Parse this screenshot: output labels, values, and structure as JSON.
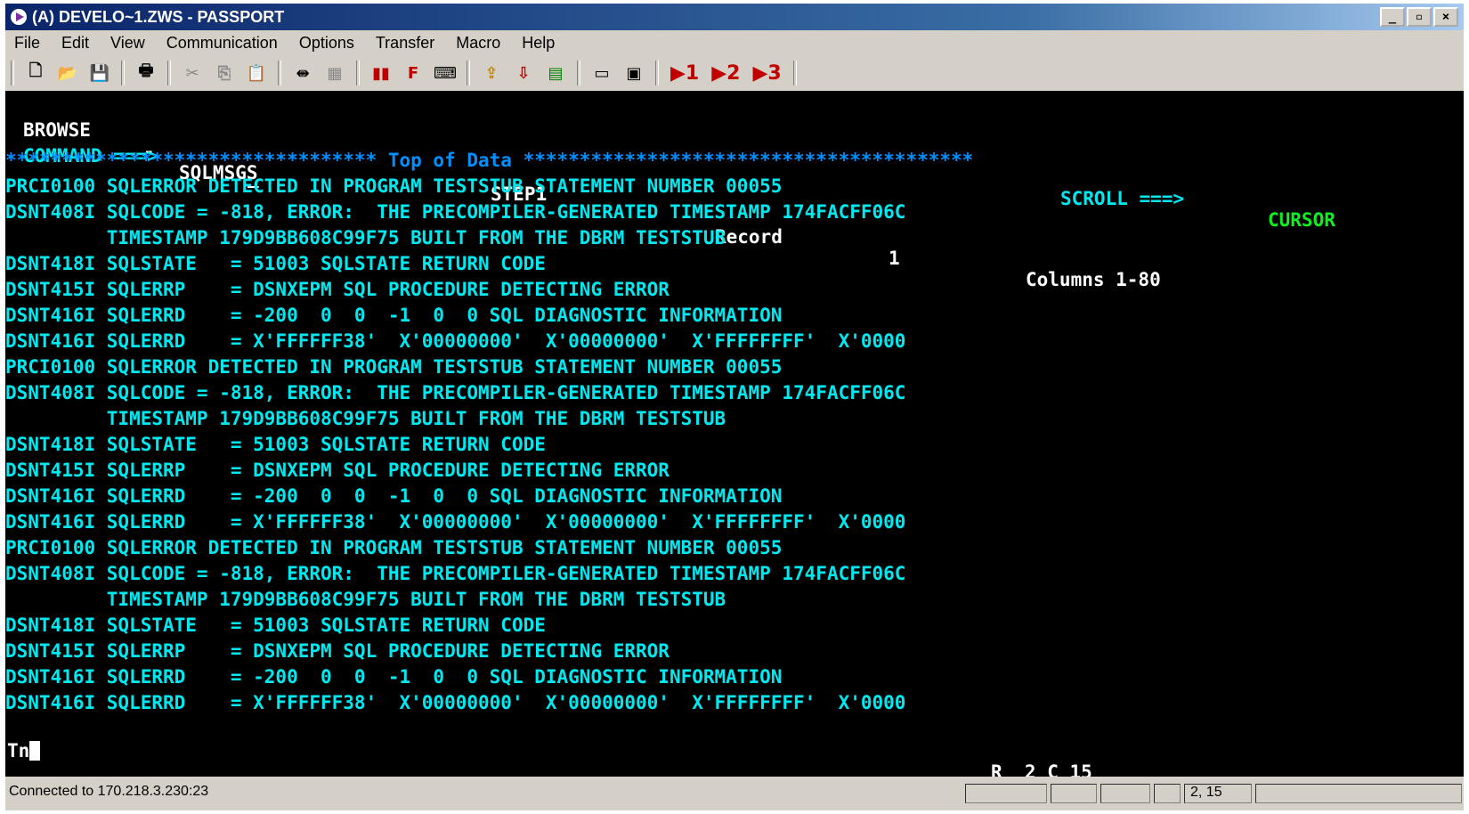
{
  "window": {
    "title": "(A) DEVELO~1.ZWS - PASSPORT",
    "controls": [
      "_",
      "▫",
      "×"
    ]
  },
  "menu": [
    "File",
    "Edit",
    "View",
    "Communication",
    "Options",
    "Transfer",
    "Macro",
    "Help"
  ],
  "toolbar": {
    "macro_buttons": [
      "▶1",
      "▶2",
      "▶3"
    ]
  },
  "terminal": {
    "header": {
      "mode": "BROWSE",
      "dash": "-",
      "dataset": "SQLMSGS",
      "step": "STEP1",
      "dash2": "-",
      "record_label": "Record",
      "record_value": "1",
      "columns": "Columns 1-80",
      "command_label": "COMMAND ===>",
      "command_value": "_",
      "scroll_label": "SCROLL ===>",
      "scroll_value": "CURSOR"
    },
    "top_of_data": "********************************* Top of Data ****************************************",
    "lines": [
      "PRCI0100 SQLERROR DETECTED IN PROGRAM TESTSTUB STATEMENT NUMBER 00055",
      "DSNT408I SQLCODE = -818, ERROR:  THE PRECOMPILER-GENERATED TIMESTAMP 174FACFF06C",
      "         TIMESTAMP 179D9BB608C99F75 BUILT FROM THE DBRM TESTSTUB",
      "DSNT418I SQLSTATE   = 51003 SQLSTATE RETURN CODE",
      "DSNT415I SQLERRP    = DSNXEPM SQL PROCEDURE DETECTING ERROR",
      "DSNT416I SQLERRD    = -200  0  0  -1  0  0 SQL DIAGNOSTIC INFORMATION",
      "DSNT416I SQLERRD    = X'FFFFFF38'  X'00000000'  X'00000000'  X'FFFFFFFF'  X'0000",
      "PRCI0100 SQLERROR DETECTED IN PROGRAM TESTSTUB STATEMENT NUMBER 00055",
      "DSNT408I SQLCODE = -818, ERROR:  THE PRECOMPILER-GENERATED TIMESTAMP 174FACFF06C",
      "         TIMESTAMP 179D9BB608C99F75 BUILT FROM THE DBRM TESTSTUB",
      "DSNT418I SQLSTATE   = 51003 SQLSTATE RETURN CODE",
      "DSNT415I SQLERRP    = DSNXEPM SQL PROCEDURE DETECTING ERROR",
      "DSNT416I SQLERRD    = -200  0  0  -1  0  0 SQL DIAGNOSTIC INFORMATION",
      "DSNT416I SQLERRD    = X'FFFFFF38'  X'00000000'  X'00000000'  X'FFFFFFFF'  X'0000",
      "PRCI0100 SQLERROR DETECTED IN PROGRAM TESTSTUB STATEMENT NUMBER 00055",
      "DSNT408I SQLCODE = -818, ERROR:  THE PRECOMPILER-GENERATED TIMESTAMP 174FACFF06C",
      "         TIMESTAMP 179D9BB608C99F75 BUILT FROM THE DBRM TESTSTUB",
      "DSNT418I SQLSTATE   = 51003 SQLSTATE RETURN CODE",
      "DSNT415I SQLERRP    = DSNXEPM SQL PROCEDURE DETECTING ERROR",
      "DSNT416I SQLERRD    = -200  0  0  -1  0  0 SQL DIAGNOSTIC INFORMATION",
      "DSNT416I SQLERRD    = X'FFFFFF38'  X'00000000'  X'00000000'  X'FFFFFFFF'  X'0000"
    ],
    "oia": {
      "left": "Tn",
      "row_col": "R  2 C 15"
    }
  },
  "status": {
    "connection": "Connected to 170.218.3.230:23",
    "cursor_pos": "2, 15"
  },
  "colors": {
    "text_cyan": "#00e8f0",
    "text_blue": "#0090ff",
    "text_green": "#10f020",
    "titlebar": "#0a246a"
  }
}
